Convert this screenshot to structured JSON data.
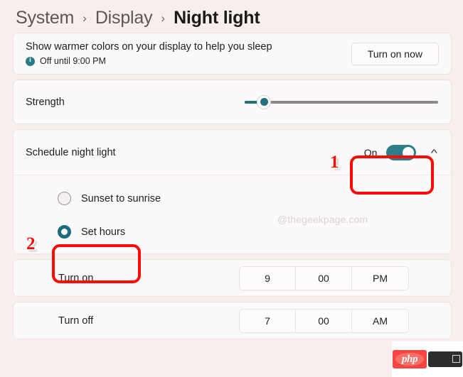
{
  "breadcrumb": {
    "items": [
      {
        "label": "System",
        "current": false
      },
      {
        "label": "Display",
        "current": false
      },
      {
        "label": "Night light",
        "current": true
      }
    ],
    "separator": "›"
  },
  "warmer_card": {
    "title": "Show warmer colors on your display to help you sleep",
    "info_icon": "info-icon",
    "status": "Off until 9:00 PM",
    "button_label": "Turn on now"
  },
  "strength_card": {
    "label": "Strength",
    "value": 9,
    "min": 0,
    "max": 100
  },
  "schedule_card": {
    "label": "Schedule night light",
    "toggle_state": "On",
    "toggle_on": true,
    "expand_icon": "chevron-up-icon",
    "options": [
      {
        "label": "Sunset to sunrise",
        "selected": false
      },
      {
        "label": "Set hours",
        "selected": true
      }
    ],
    "watermark": "@thegeekpage.com"
  },
  "turn_on_row": {
    "label": "Turn on",
    "hour": "9",
    "minute": "00",
    "meridiem": "PM"
  },
  "turn_off_row": {
    "label": "Turn off",
    "hour": "7",
    "minute": "00",
    "meridiem": "AM"
  },
  "annotations": {
    "step1": "1",
    "step2": "2"
  },
  "php_badge": {
    "logo_text": "php"
  },
  "colors": {
    "accent_teal": "#2d7d8a",
    "annotation_red": "#fc0b03",
    "page_background": "#f6efee",
    "card_background": "#fbf9f9"
  }
}
